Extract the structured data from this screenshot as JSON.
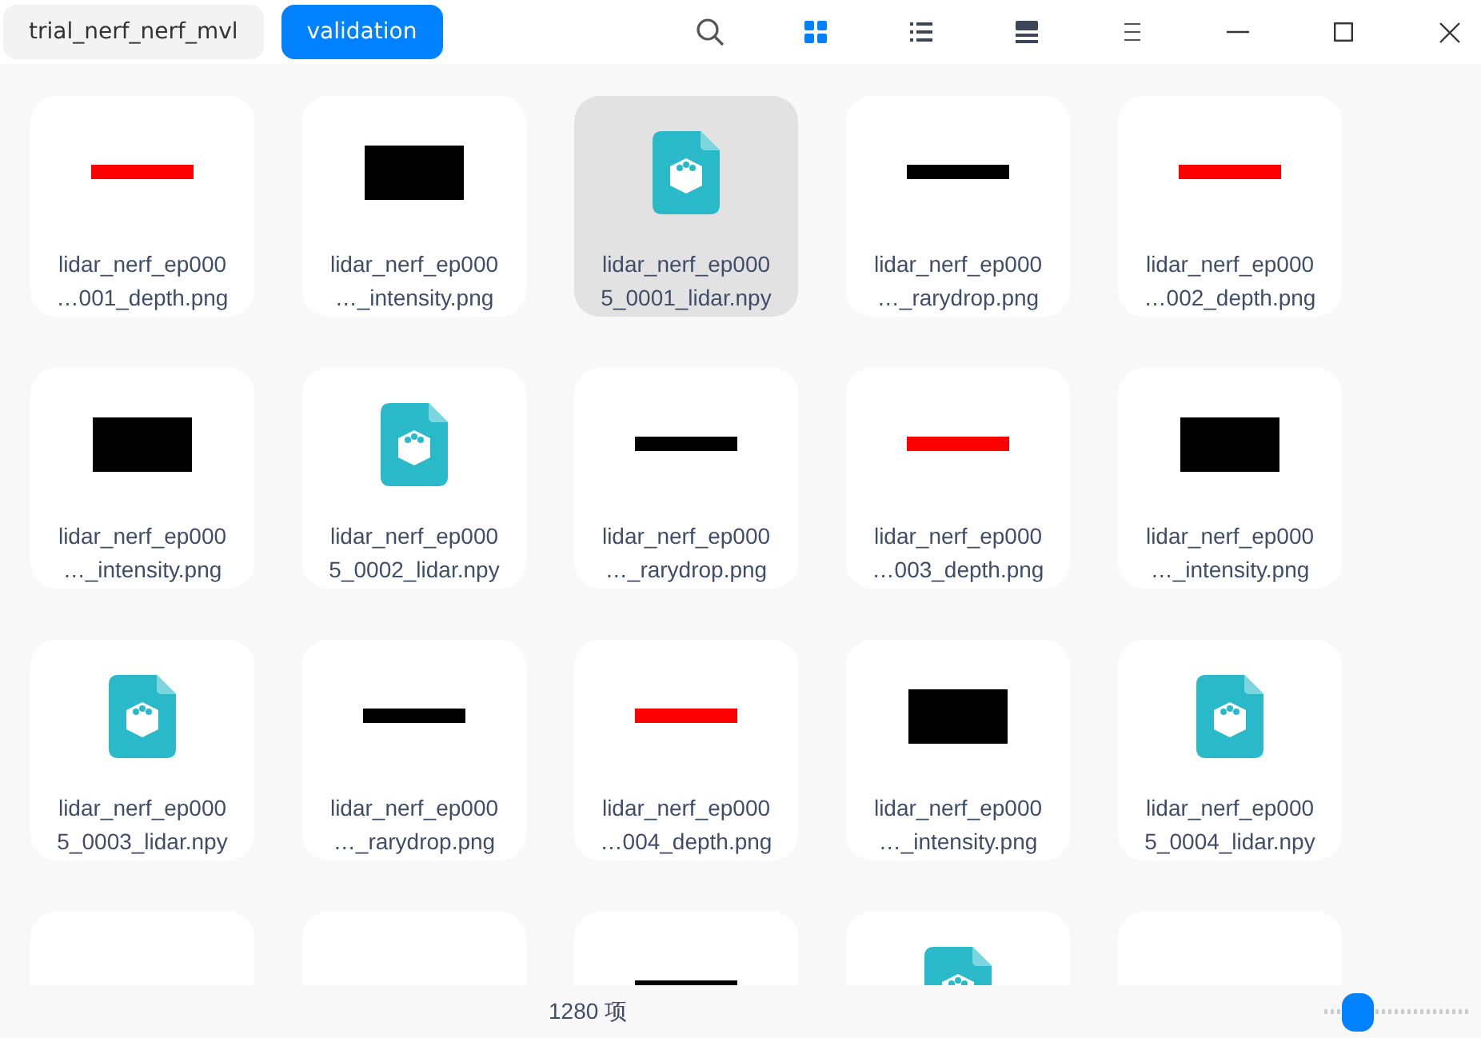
{
  "breadcrumbs": [
    {
      "label": "trial_nerf_nerf_mvl",
      "selected": false
    },
    {
      "label": "validation",
      "selected": true
    }
  ],
  "view_modes": [
    {
      "kind": "icons",
      "selected": true
    },
    {
      "kind": "list",
      "selected": false
    },
    {
      "kind": "tree",
      "selected": false
    }
  ],
  "files": [
    {
      "kind": "depth",
      "name": "lidar_nerf_ep000",
      "name_2": "…001_depth.png",
      "selected": false
    },
    {
      "kind": "intensity",
      "name": "lidar_nerf_ep000",
      "name_2": "…_intensity.png",
      "selected": false
    },
    {
      "kind": "lidar",
      "name": "lidar_nerf_ep000",
      "name_2": "5_0001_lidar.npy",
      "selected": true
    },
    {
      "kind": "raydrop",
      "name": "lidar_nerf_ep000",
      "name_2": "…_rarydrop.png",
      "selected": false
    },
    {
      "kind": "depth",
      "name": "lidar_nerf_ep000",
      "name_2": "…002_depth.png",
      "selected": false
    },
    {
      "kind": "intensity",
      "name": "lidar_nerf_ep000",
      "name_2": "…_intensity.png",
      "selected": false
    },
    {
      "kind": "lidar",
      "name": "lidar_nerf_ep000",
      "name_2": "5_0002_lidar.npy",
      "selected": false
    },
    {
      "kind": "raydrop",
      "name": "lidar_nerf_ep000",
      "name_2": "…_rarydrop.png",
      "selected": false
    },
    {
      "kind": "depth",
      "name": "lidar_nerf_ep000",
      "name_2": "…003_depth.png",
      "selected": false
    },
    {
      "kind": "intensity",
      "name": "lidar_nerf_ep000",
      "name_2": "…_intensity.png",
      "selected": false
    },
    {
      "kind": "lidar",
      "name": "lidar_nerf_ep000",
      "name_2": "5_0003_lidar.npy",
      "selected": false
    },
    {
      "kind": "raydrop",
      "name": "lidar_nerf_ep000",
      "name_2": "…_rarydrop.png",
      "selected": false
    },
    {
      "kind": "depth",
      "name": "lidar_nerf_ep000",
      "name_2": "…004_depth.png",
      "selected": false
    },
    {
      "kind": "intensity",
      "name": "lidar_nerf_ep000",
      "name_2": "…_intensity.png",
      "selected": false
    },
    {
      "kind": "lidar",
      "name": "lidar_nerf_ep000",
      "name_2": "5_0004_lidar.npy",
      "selected": false
    },
    {
      "kind": "empty",
      "selected": false
    },
    {
      "kind": "empty",
      "selected": false
    },
    {
      "kind": "raydrop",
      "selected": false
    },
    {
      "kind": "lidar",
      "selected": false
    },
    {
      "kind": "empty",
      "selected": false
    }
  ],
  "status_bar": {
    "count": "1280 项",
    "zoom": {
      "level": 0.15
    }
  }
}
